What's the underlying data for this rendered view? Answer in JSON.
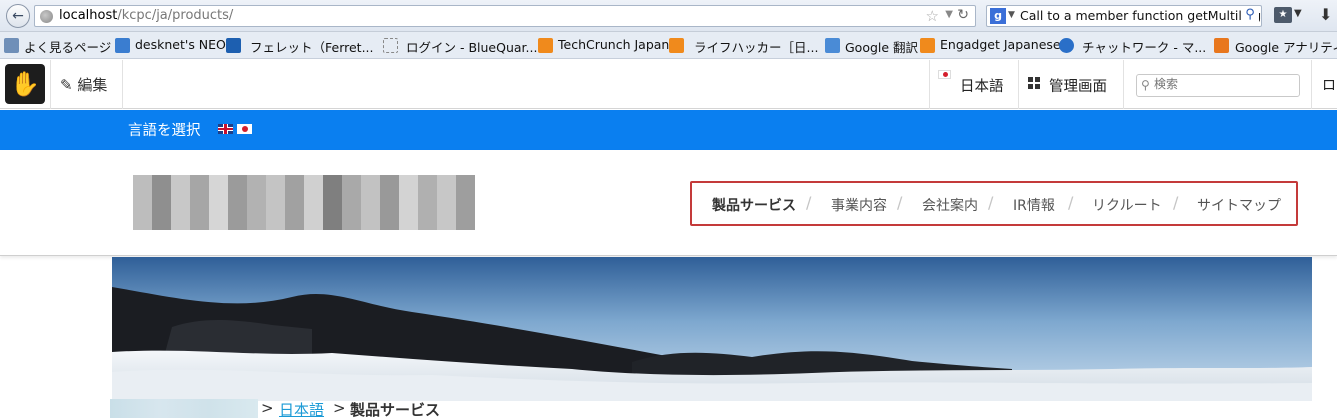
{
  "browser": {
    "url_host": "localhost",
    "url_path": "/kcpc/ja/products/",
    "search_value": "Call to a member function getMultiling"
  },
  "bookmarks": [
    {
      "label": "よく見るページ",
      "icon": "magnifier-icon"
    },
    {
      "label": "desknet's NEO",
      "icon": "desknets-icon"
    },
    {
      "label": "フェレット（Ferret...",
      "icon": "ferret-icon"
    },
    {
      "label": "ログイン - BlueQuar...",
      "icon": "dotted-square-icon"
    },
    {
      "label": "TechCrunch Japan",
      "icon": "rss-icon"
    },
    {
      "label": "ライフハッカー［日...",
      "icon": "rss-icon"
    },
    {
      "label": "Google 翻訳",
      "icon": "translate-icon"
    },
    {
      "label": "Engadget Japanese",
      "icon": "rss-icon"
    },
    {
      "label": "チャットワーク - マ...",
      "icon": "chatwork-icon"
    },
    {
      "label": "Google アナリティ",
      "icon": "analytics-icon"
    }
  ],
  "cms_toolbar": {
    "edit_label": "編集",
    "language_label": "日本語",
    "admin_label": "管理画面",
    "search_placeholder": "検索",
    "logout_label": "ロ"
  },
  "lang_strip": {
    "label": "言語を選択"
  },
  "nav": {
    "items": [
      "製品サービス",
      "事業内容",
      "会社案内",
      "IR情報",
      "リクルート",
      "サイトマップ"
    ],
    "active_index": 0
  },
  "breadcrumb": {
    "sep1": ">",
    "link": "日本語",
    "sep2": ">",
    "current": "製品サービス"
  },
  "colors": {
    "lang_strip": "#0a7ff0",
    "nav_highlight_border": "#c43a3a",
    "breadcrumb_link": "#1a9ad6"
  }
}
